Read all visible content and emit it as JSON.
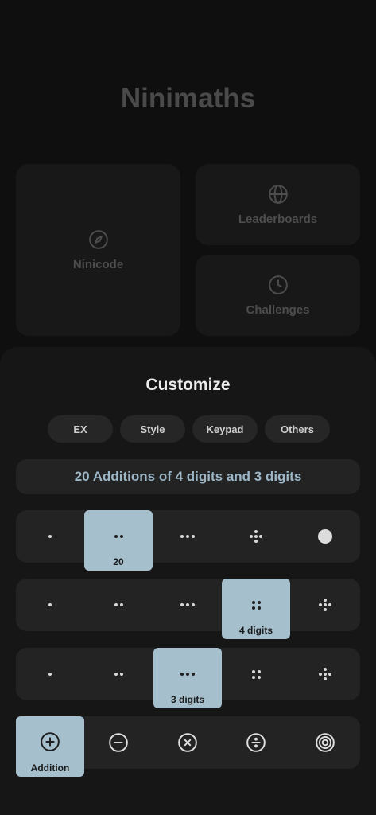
{
  "home": {
    "title": "Ninimaths",
    "tiles": {
      "ninicode": "Ninicode",
      "leaderboards": "Leaderboards",
      "challenges": "Challenges"
    }
  },
  "customize": {
    "title": "Customize",
    "tabs": [
      "EX",
      "Style",
      "Keypad",
      "Others"
    ],
    "summary": "20 Additions of 4 digits and 3 digits",
    "count_row": {
      "selected_index": 1,
      "selected_label": "20"
    },
    "digits_row_a": {
      "selected_index": 3,
      "selected_label": "4 digits"
    },
    "digits_row_b": {
      "selected_index": 2,
      "selected_label": "3 digits"
    },
    "operations": {
      "selected_index": 0,
      "selected_label": "Addition",
      "icons": [
        "plus-circle-icon",
        "minus-circle-icon",
        "times-circle-icon",
        "divide-circle-icon",
        "target-icon"
      ]
    }
  },
  "colors": {
    "selected_cell": "#a5bfcc",
    "summary_text": "#9cb6c6",
    "sheet_bg": "#161616"
  }
}
